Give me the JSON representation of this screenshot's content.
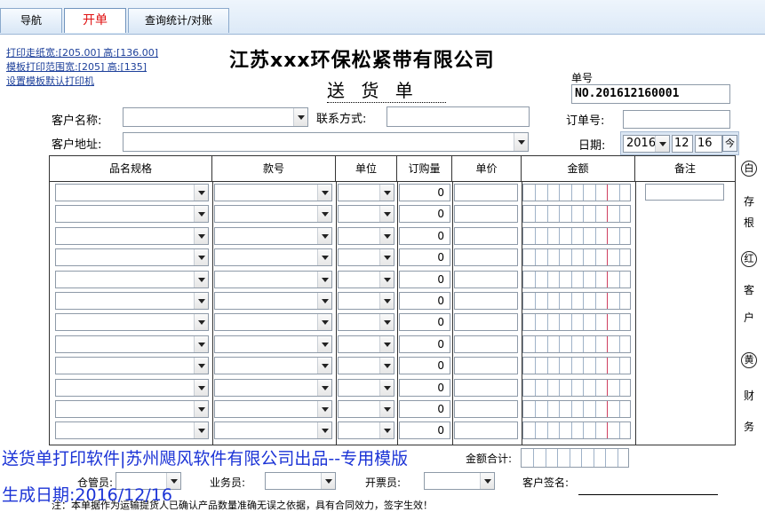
{
  "tabs": [
    {
      "label": "导航"
    },
    {
      "label": "开单"
    },
    {
      "label": "查询统计/对账"
    }
  ],
  "print_links": {
    "paper_width": "打印走纸宽:[205.00] 高:[136.00]",
    "template_range": "模板打印范围宽:[205] 高:[135]",
    "default_printer": "设置模板默认打印机"
  },
  "company_title": "江苏xxx环保松紧带有限公司",
  "doc_title": "送 货 单",
  "order_number": {
    "label": "单号",
    "value": "NO.201612160001"
  },
  "form": {
    "customer_name_label": "客户名称:",
    "contact_label": "联系方式:",
    "order_no_label": "订单号:",
    "customer_address_label": "客户地址:",
    "date_label": "日期:",
    "date_year": "2016",
    "date_month": "12",
    "date_day": "16",
    "today_button": "今"
  },
  "table": {
    "headers": [
      "品名规格",
      "款号",
      "单位",
      "订购量",
      "单价",
      "金额",
      "备注"
    ],
    "rows": [
      "0",
      "0",
      "0",
      "0",
      "0",
      "0",
      "0",
      "0",
      "0",
      "0",
      "0",
      "0"
    ]
  },
  "side_labels": [
    "白",
    "存",
    "根",
    "红",
    "客",
    "户",
    "黄",
    "财",
    "务"
  ],
  "totals": {
    "amount_total_label": "金额合计:"
  },
  "footer": {
    "warehouse_label": "仓管员:",
    "sales_label": "业务员:",
    "invoice_label": "开票员:",
    "customer_sign_label": "客户签名:",
    "note": "注：本单据作为运输提货人已确认产品数量准确无误之依据，具有合同效力，签字生效！"
  },
  "overlay": {
    "line1": "送货单打印软件|苏州飓风软件有限公司出品--专用模版",
    "line2": "生成日期:2016/12/16"
  }
}
